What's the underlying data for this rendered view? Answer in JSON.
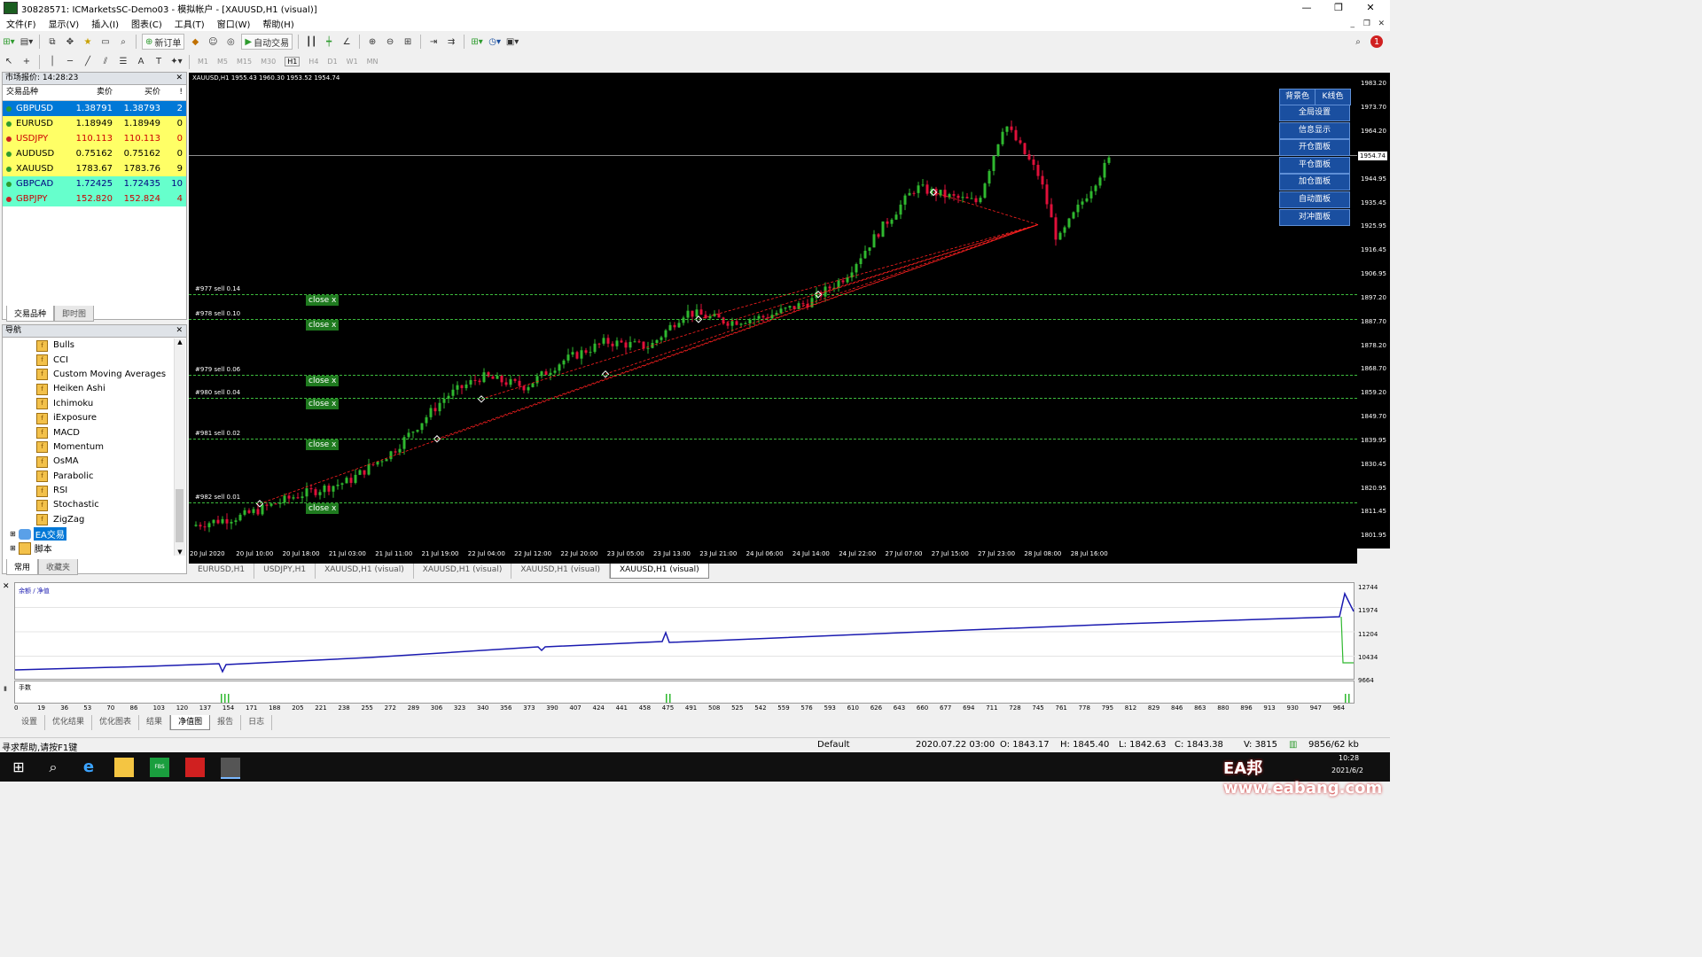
{
  "window": {
    "title": "30828571: ICMarketsSC-Demo03 - 模拟帐户 - [XAUUSD,H1 (visual)]"
  },
  "menu": [
    "文件(F)",
    "显示(V)",
    "插入(I)",
    "图表(C)",
    "工具(T)",
    "窗口(W)",
    "帮助(H)"
  ],
  "toolbar": {
    "new_order": "新订单",
    "auto_trade": "自动交易"
  },
  "timeframes": [
    "M1",
    "M5",
    "M15",
    "M30",
    "H1",
    "H4",
    "D1",
    "W1",
    "MN"
  ],
  "market_watch": {
    "title": "市场报价: 14:28:23",
    "headers": {
      "symbol": "交易品种",
      "bid": "卖价",
      "ask": "买价",
      "spread": "!"
    },
    "rows": [
      {
        "symbol": "GBPUSD",
        "bid": "1.38791",
        "ask": "1.38793",
        "spread": "2",
        "bg": "#0078d7",
        "fg": "#ffffff",
        "dot": "#2e9b2e"
      },
      {
        "symbol": "EURUSD",
        "bid": "1.18949",
        "ask": "1.18949",
        "spread": "0",
        "bg": "#ffff66",
        "fg": "#000000",
        "dot": "#2e9b2e"
      },
      {
        "symbol": "USDJPY",
        "bid": "110.113",
        "ask": "110.113",
        "spread": "0",
        "bg": "#ffff66",
        "fg": "#cc0000",
        "dot": "#cc2222"
      },
      {
        "symbol": "AUDUSD",
        "bid": "0.75162",
        "ask": "0.75162",
        "spread": "0",
        "bg": "#ffff66",
        "fg": "#000000",
        "dot": "#2e9b2e"
      },
      {
        "symbol": "XAUUSD",
        "bid": "1783.67",
        "ask": "1783.76",
        "spread": "9",
        "bg": "#ffff66",
        "fg": "#000000",
        "dot": "#2e9b2e"
      },
      {
        "symbol": "GBPCAD",
        "bid": "1.72425",
        "ask": "1.72435",
        "spread": "10",
        "bg": "#66ffcc",
        "fg": "#000080",
        "dot": "#2e9b2e"
      },
      {
        "symbol": "GBPJPY",
        "bid": "152.820",
        "ask": "152.824",
        "spread": "4",
        "bg": "#66ffcc",
        "fg": "#cc0000",
        "dot": "#cc2222"
      }
    ],
    "tabs": [
      "交易品种",
      "即时图"
    ]
  },
  "navigator": {
    "title": "导航",
    "items": [
      "Bulls",
      "CCI",
      "Custom Moving Averages",
      "Heiken Ashi",
      "Ichimoku",
      "iExposure",
      "MACD",
      "Momentum",
      "OsMA",
      "Parabolic",
      "RSI",
      "Stochastic",
      "ZigZag"
    ],
    "ea": "EA交易",
    "scripts": "脚本",
    "tabs": [
      "常用",
      "收藏夹"
    ]
  },
  "chart": {
    "info": "XAUUSD,H1  1955.43 1960.30 1953.52 1954.74",
    "current_price": "1954.74",
    "y_ticks": [
      "1983.20",
      "1973.70",
      "1964.20",
      "1944.95",
      "1935.45",
      "1925.95",
      "1916.45",
      "1906.95",
      "1897.20",
      "1887.70",
      "1878.20",
      "1868.70",
      "1859.20",
      "1849.70",
      "1839.95",
      "1830.45",
      "1820.95",
      "1811.45",
      "1801.95"
    ],
    "x_ticks": [
      "20 Jul 2020",
      "20 Jul 10:00",
      "20 Jul 18:00",
      "21 Jul 03:00",
      "21 Jul 11:00",
      "21 Jul 19:00",
      "22 Jul 04:00",
      "22 Jul 12:00",
      "22 Jul 20:00",
      "23 Jul 05:00",
      "23 Jul 13:00",
      "23 Jul 21:00",
      "24 Jul 06:00",
      "24 Jul 14:00",
      "24 Jul 22:00",
      "27 Jul 07:00",
      "27 Jul 15:00",
      "27 Jul 23:00",
      "28 Jul 08:00",
      "28 Jul 16:00"
    ],
    "orders": [
      {
        "label": "#977 sell 0.14",
        "close": "close x",
        "price": 1899.2
      },
      {
        "label": "#978 sell 0.10",
        "close": "close x",
        "price": 1889.2
      },
      {
        "label": "#979 sell 0.06",
        "close": "close x",
        "price": 1866.6
      },
      {
        "label": "#980 sell 0.04",
        "close": "close x",
        "price": 1857.3
      },
      {
        "label": "#981 sell 0.02",
        "close": "close x",
        "price": 1841.1
      },
      {
        "label": "#982 sell 0.01",
        "close": "close x",
        "price": 1815.6
      }
    ],
    "panel_buttons": [
      "背景色",
      "K线色",
      "全局设置",
      "信息显示",
      "开仓面板",
      "平仓面板",
      "加仓面板",
      "自动面板",
      "对冲面板"
    ],
    "colors": {
      "bull": "#2fb82f",
      "bear": "#e0103a",
      "order_line": "#3cba3c",
      "trend": "#ff2020"
    }
  },
  "chart_tabs": [
    "EURUSD,H1",
    "USDJPY,H1",
    "XAUUSD,H1 (visual)",
    "XAUUSD,H1 (visual)",
    "XAUUSD,H1 (visual)",
    "XAUUSD,H1 (visual)"
  ],
  "equity": {
    "legend": "余额 / 净值",
    "vol_label": "手数",
    "y_ticks": [
      "12744",
      "11974",
      "11204",
      "10434",
      "9664"
    ],
    "x_ticks": [
      "0",
      "19",
      "36",
      "53",
      "70",
      "86",
      "103",
      "120",
      "137",
      "154",
      "171",
      "188",
      "205",
      "221",
      "238",
      "255",
      "272",
      "289",
      "306",
      "323",
      "340",
      "356",
      "373",
      "390",
      "407",
      "424",
      "441",
      "458",
      "475",
      "491",
      "508",
      "525",
      "542",
      "559",
      "576",
      "593",
      "610",
      "626",
      "643",
      "660",
      "677",
      "694",
      "711",
      "728",
      "745",
      "761",
      "778",
      "795",
      "812",
      "829",
      "846",
      "863",
      "880",
      "896",
      "913",
      "930",
      "947",
      "964"
    ]
  },
  "bottom_tabs": [
    "设置",
    "优化结果",
    "优化图表",
    "结果",
    "净值图",
    "报告",
    "日志"
  ],
  "status": {
    "help": "寻求帮助,请按F1键",
    "profile": "Default",
    "datetime": "2020.07.22 03:00",
    "open": "O: 1843.17",
    "high": "H: 1845.40",
    "low": "L: 1842.63",
    "close": "C: 1843.38",
    "volume": "V: 3815",
    "traffic": "9856/62 kb"
  },
  "taskbar": {
    "time": "10:28",
    "date": "2021/6/2",
    "watermark": "EA邦 www.eabang.com"
  }
}
